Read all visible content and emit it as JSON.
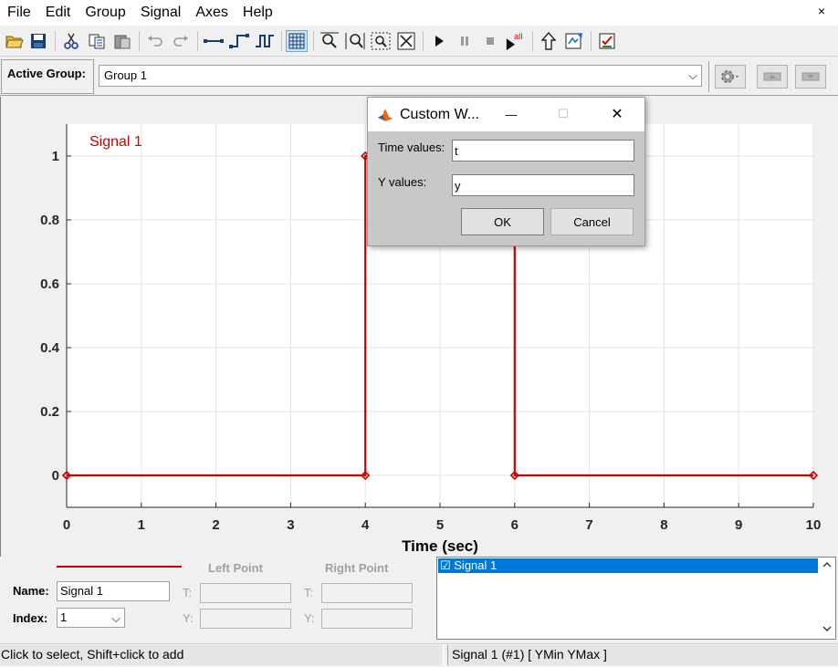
{
  "menu": [
    "File",
    "Edit",
    "Group",
    "Signal",
    "Axes",
    "Help"
  ],
  "menu_close": "×",
  "toolbar": {
    "tools": [
      "open-icon",
      "save-icon",
      "cut-icon",
      "copy-icon",
      "paste-icon",
      "undo-icon",
      "redo-icon",
      "line-icon",
      "step-icon",
      "pulse-icon",
      "grid-icon",
      "zoom-y-icon",
      "zoom-x-icon",
      "zoom-box-icon",
      "fit-icon",
      "start-icon",
      "pause-icon",
      "stop-icon",
      "run-all-icon",
      "up-icon",
      "export-icon",
      "check-icon"
    ],
    "run_all_label": "all"
  },
  "group_bar": {
    "label": "Active Group:",
    "selected": "Group 1",
    "arrow": "⌵"
  },
  "plot": {
    "xlabel": "Time (sec)",
    "legend": "Signal 1"
  },
  "chart_data": {
    "type": "line",
    "series": [
      {
        "name": "Signal 1",
        "color": "#cc0000",
        "x": [
          0,
          4,
          4,
          6,
          6,
          10
        ],
        "y": [
          0,
          0,
          1,
          1,
          0,
          0
        ],
        "markers": [
          [
            0,
            0
          ],
          [
            4,
            0
          ],
          [
            4,
            1
          ],
          [
            6,
            0
          ],
          [
            10,
            0
          ]
        ]
      }
    ],
    "xlim": [
      0,
      10
    ],
    "ylim": [
      -0.1,
      1.1
    ],
    "x_ticks": [
      "0",
      "1",
      "2",
      "3",
      "4",
      "5",
      "6",
      "7",
      "8",
      "9",
      "10"
    ],
    "y_ticks": [
      "0",
      "0.2",
      "0.4",
      "0.6",
      "0.8",
      "1"
    ],
    "xlabel": "Time (sec)",
    "grid": true
  },
  "bottom": {
    "name_label": "Name:",
    "name_value": "Signal 1",
    "index_label": "Index:",
    "index_value": "1",
    "index_arrow": "⌵",
    "left_point": "Left Point",
    "right_point": "Right Point",
    "t_label": "T:",
    "y_label": "Y:",
    "signal_list_item": "☑ Signal 1"
  },
  "status": {
    "left": "Click to select, Shift+click to add",
    "right": "Signal 1 (#1)  [ YMin YMax ]"
  },
  "dialog": {
    "title": "Custom W...",
    "minimize": "—",
    "maximize": "☐",
    "close": "✕",
    "time_label": "Time values:",
    "time_value": "t",
    "y_label": "Y values:",
    "y_value": "y",
    "ok": "OK",
    "cancel": "Cancel"
  }
}
